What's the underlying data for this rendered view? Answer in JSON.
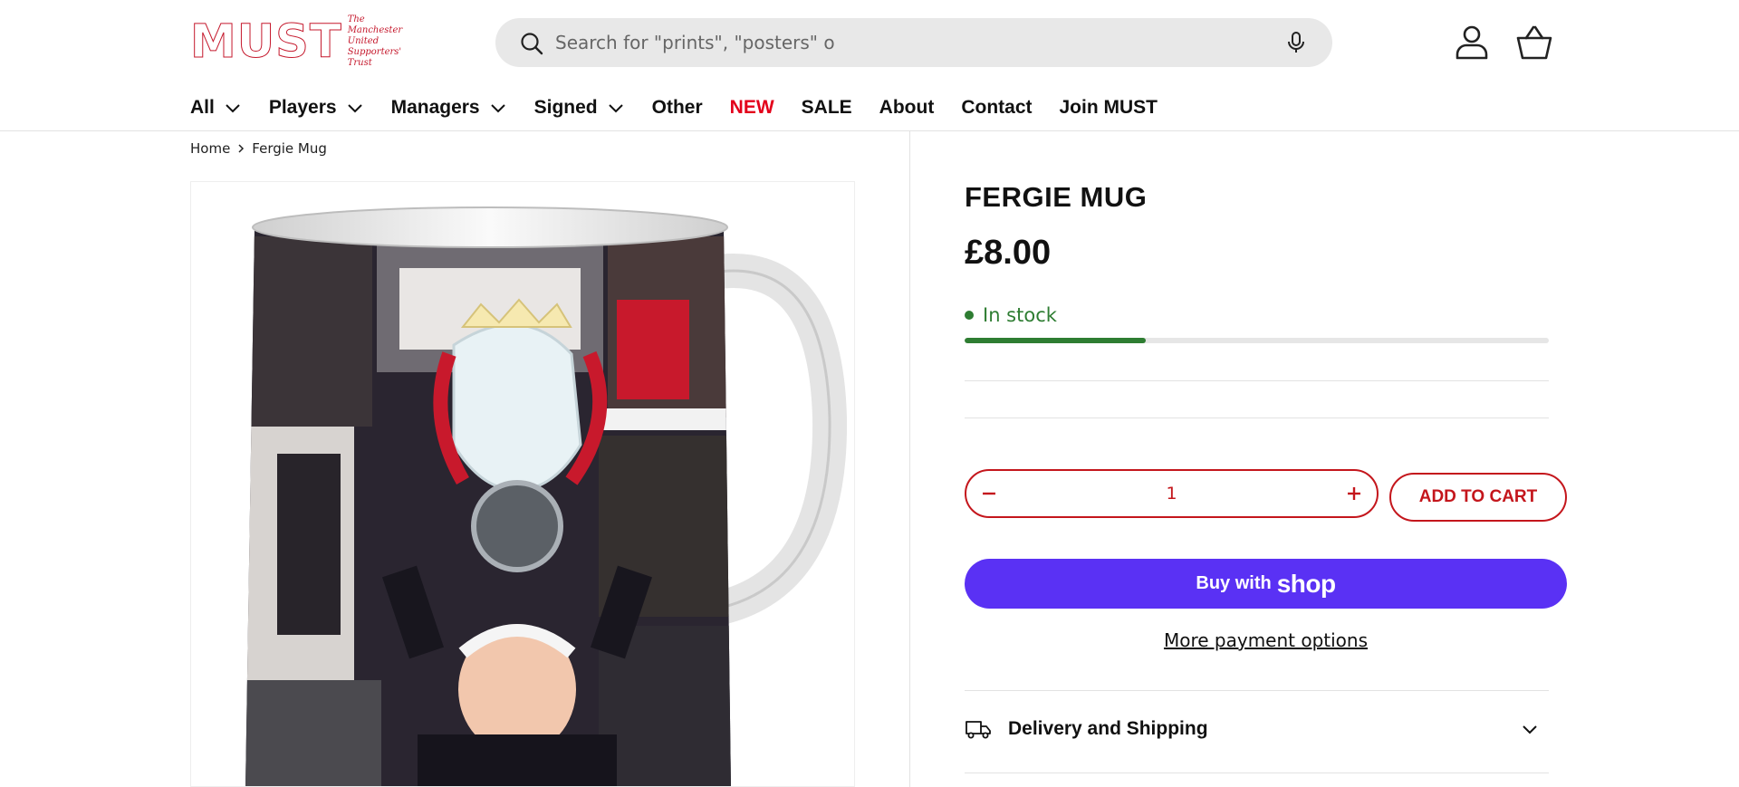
{
  "brand": {
    "logo_text": "MUST",
    "logo_sub": [
      "The",
      "Manchester",
      "United",
      "Supporters'",
      "Trust"
    ],
    "accent_color": "#c5192d"
  },
  "search": {
    "placeholder": "Search for \"prints\", \"posters\" o"
  },
  "nav": {
    "items": [
      {
        "label": "All",
        "has_dropdown": true
      },
      {
        "label": "Players",
        "has_dropdown": true
      },
      {
        "label": "Managers",
        "has_dropdown": true
      },
      {
        "label": "Signed",
        "has_dropdown": true
      },
      {
        "label": "Other",
        "has_dropdown": false
      },
      {
        "label": "NEW",
        "has_dropdown": false,
        "highlight": "#e3001b"
      },
      {
        "label": "SALE",
        "has_dropdown": false
      },
      {
        "label": "About",
        "has_dropdown": false
      },
      {
        "label": "Contact",
        "has_dropdown": false
      },
      {
        "label": "Join MUST",
        "has_dropdown": false
      }
    ]
  },
  "breadcrumb": {
    "home": "Home",
    "current": "Fergie Mug"
  },
  "product": {
    "title": "FERGIE MUG",
    "price": "£8.00",
    "stock_status": "In stock",
    "stock_level_fraction": 0.31,
    "quantity": "1",
    "add_to_cart": "ADD TO CART",
    "buy_with": "Buy with",
    "shop_brand": "shop",
    "more_payment": "More payment options",
    "delivery_label": "Delivery and Shipping"
  },
  "colors": {
    "stock_green": "#2e7d32",
    "cart_red": "#c4161c",
    "shop_pay_purple": "#5a31f4"
  },
  "icons": [
    "search-icon",
    "microphone-icon",
    "account-icon",
    "basket-icon",
    "chevron-down-icon",
    "chevron-right-icon",
    "minus-icon",
    "plus-icon",
    "truck-icon"
  ]
}
